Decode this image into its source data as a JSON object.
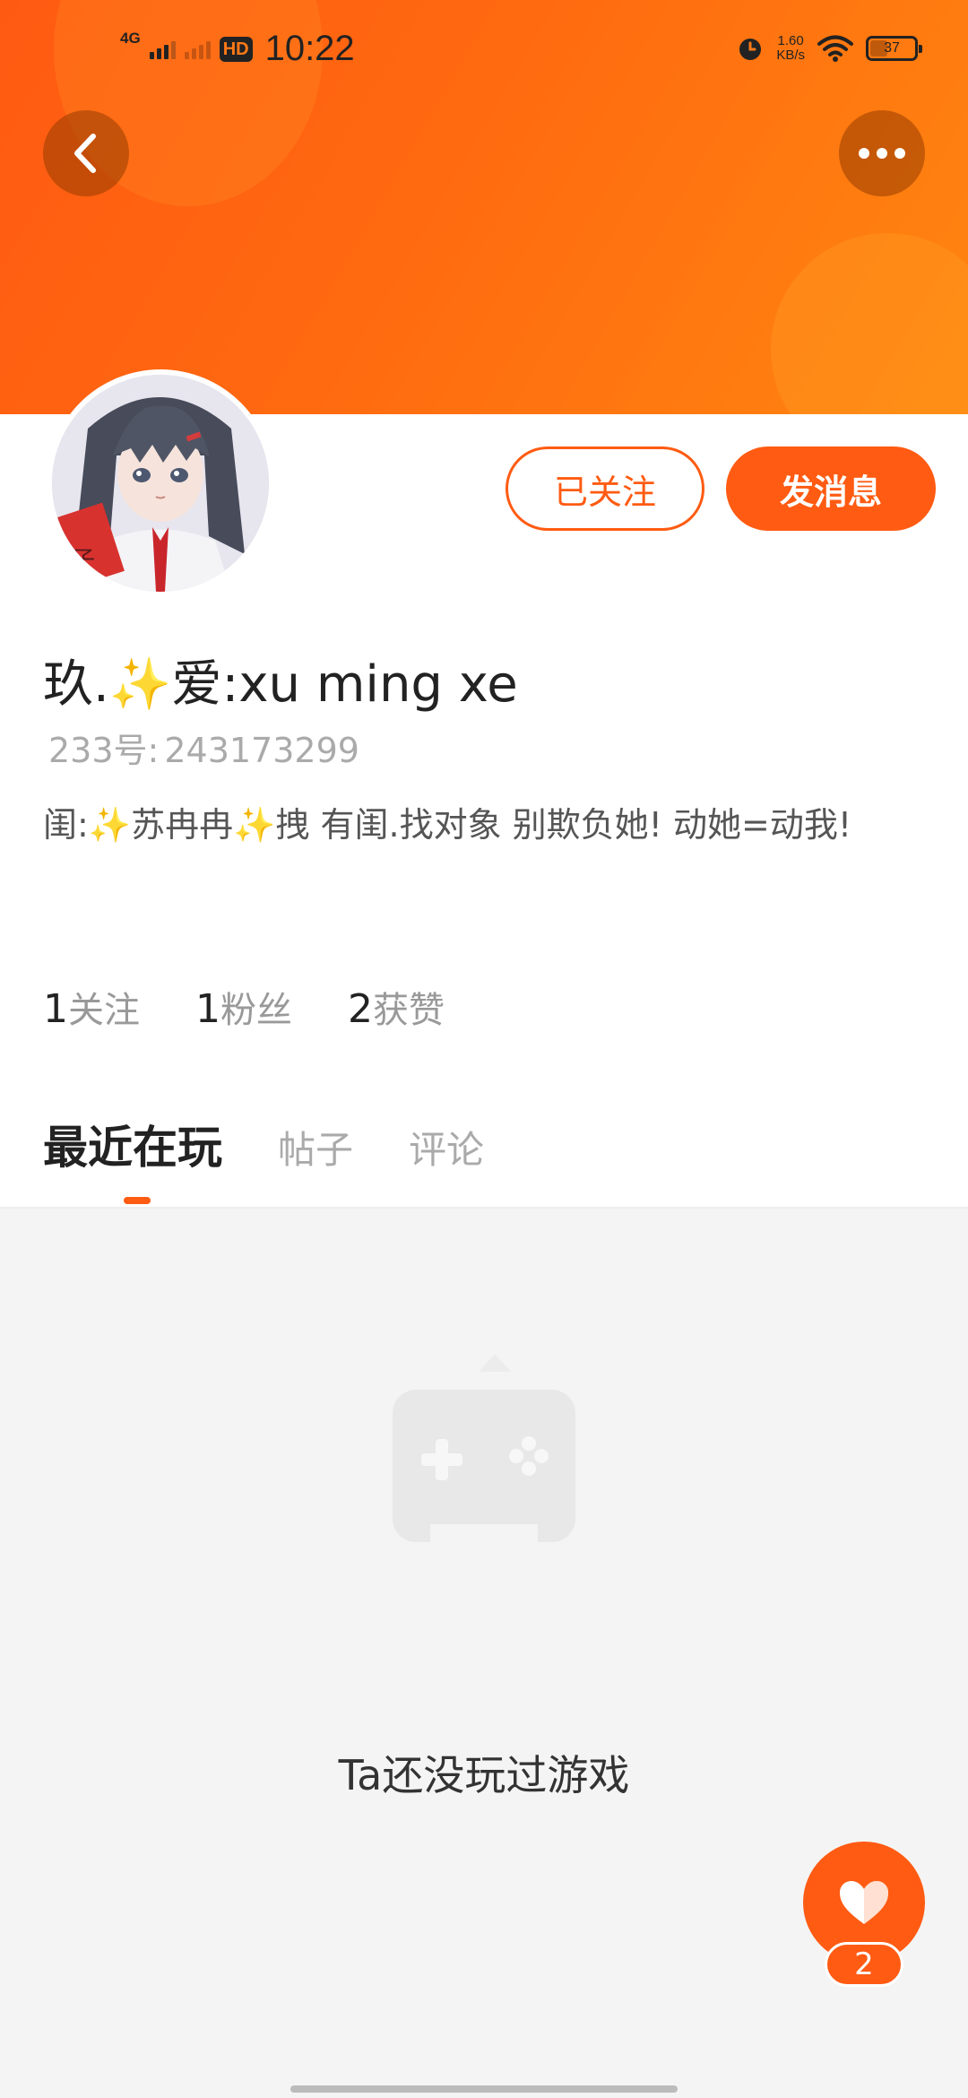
{
  "status_bar": {
    "network": "4G",
    "hd": "HD",
    "time": "10:22",
    "speed_value": "1.60",
    "speed_unit": "KB/s",
    "battery": "37"
  },
  "header": {
    "back_icon": "chevron-left-icon",
    "more_icon": "more-horizontal-icon",
    "accent": "#ff5b12"
  },
  "profile": {
    "username": "玖.✨爱:xu ming xe",
    "id_label": "233号:",
    "id_value": "243173299",
    "bio": "闺:✨苏冉冉✨拽 有闺.找对象 别欺负她! 动她=动我!",
    "follow_button": "已关注",
    "message_button": "发消息"
  },
  "stats": [
    {
      "value": "1",
      "label": "关注"
    },
    {
      "value": "1",
      "label": "粉丝"
    },
    {
      "value": "2",
      "label": "获赞"
    }
  ],
  "tabs": [
    {
      "label": "最近在玩",
      "active": true
    },
    {
      "label": "帖子",
      "active": false
    },
    {
      "label": "评论",
      "active": false
    }
  ],
  "empty_state": {
    "icon": "gamepad-icon",
    "text": "Ta还没玩过游戏"
  },
  "like": {
    "icon": "heart-icon",
    "count": "2"
  }
}
